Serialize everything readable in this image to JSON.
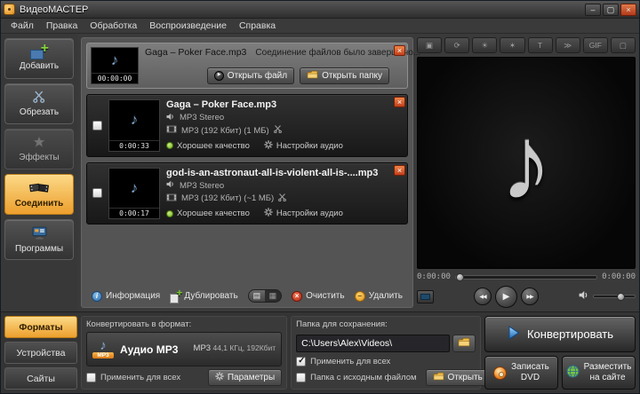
{
  "window": {
    "title": "ВидеоМАСТЕР",
    "controls": {
      "minimize": "–",
      "maximize": "▢",
      "close": "×"
    }
  },
  "menubar": {
    "items": [
      "Файл",
      "Правка",
      "Обработка",
      "Воспроизведение",
      "Справка"
    ]
  },
  "sidebar": {
    "items": [
      {
        "label": "Добавить"
      },
      {
        "label": "Обрезать"
      },
      {
        "label": "Эффекты"
      },
      {
        "label": "Соединить",
        "active": true
      },
      {
        "label": "Программы"
      }
    ]
  },
  "bottom_tabs": {
    "items": [
      {
        "label": "Форматы",
        "active": true
      },
      {
        "label": "Устройства"
      },
      {
        "label": "Сайты"
      }
    ]
  },
  "notification": {
    "filename": "Gaga – Poker Face.mp3",
    "message": "Соединение файлов было завершено...",
    "time": "00:00:00",
    "open_file_label": "Открыть файл",
    "open_folder_label": "Открыть папку"
  },
  "files": [
    {
      "title": "Gaga – Poker Face.mp3",
      "audio": "MP3 Stereo",
      "format": "MP3 (192 Кбит) (1 МБ)",
      "duration": "0:00:33",
      "quality_label": "Хорошее качество",
      "settings_label": "Настройки аудио",
      "checked": false
    },
    {
      "title": "god-is-an-astronaut-all-is-violent-all-is-....mp3",
      "audio": "MP3 Stereo",
      "format": "MP3 (192 Кбит) (~1 МБ)",
      "duration": "0:00:17",
      "quality_label": "Хорошее качество",
      "settings_label": "Настройки аудио",
      "checked": false
    }
  ],
  "list_toolbar": {
    "info_label": "Информация",
    "duplicate_label": "Дублировать",
    "clear_label": "Очистить",
    "delete_label": "Удалить"
  },
  "preview_toolbar": {
    "icons": [
      {
        "name": "crop-icon",
        "glyph": "▣"
      },
      {
        "name": "rotate-icon",
        "glyph": "⟳"
      },
      {
        "name": "brightness-icon",
        "glyph": "☀"
      },
      {
        "name": "effects-icon",
        "glyph": "✶"
      },
      {
        "name": "text-icon",
        "glyph": "T"
      },
      {
        "name": "speed-icon",
        "glyph": "≫"
      },
      {
        "name": "gif-icon",
        "glyph": "GIF"
      },
      {
        "name": "screen-icon",
        "glyph": "▢"
      }
    ]
  },
  "preview": {
    "time_current": "0:00:00",
    "time_total": "0:00:00"
  },
  "icons": {
    "close": "×",
    "prev": "◀◀",
    "play": "▶",
    "next": "▶▶",
    "music_note": "♪"
  },
  "format_panel": {
    "header": "Конвертировать в формат:",
    "format_title": "Аудио MP3",
    "icon_badge": "MP3",
    "format_code": "MP3",
    "format_details": "44,1 КГц, 192Кбит",
    "apply_all_label": "Применить для всех",
    "apply_all_checked": false,
    "params_label": "Параметры"
  },
  "save_panel": {
    "header": "Папка для сохранения:",
    "path": "C:\\Users\\Alex\\Videos\\",
    "apply_all_label": "Применить для всех",
    "apply_all_checked": true,
    "source_folder_label": "Папка с исходным файлом",
    "source_folder_checked": false,
    "open_folder_label": "Открыть папку"
  },
  "actions": {
    "convert_label": "Конвертировать",
    "dvd_line1": "Записать",
    "dvd_line2": "DVD",
    "site_line1": "Разместить",
    "site_line2": "на сайте"
  },
  "colors": {
    "accent_orange": "#ec9f2d",
    "quality_green": "#77b626",
    "panel_dark": "#2b2b2b",
    "close_red": "#c23f1c"
  }
}
